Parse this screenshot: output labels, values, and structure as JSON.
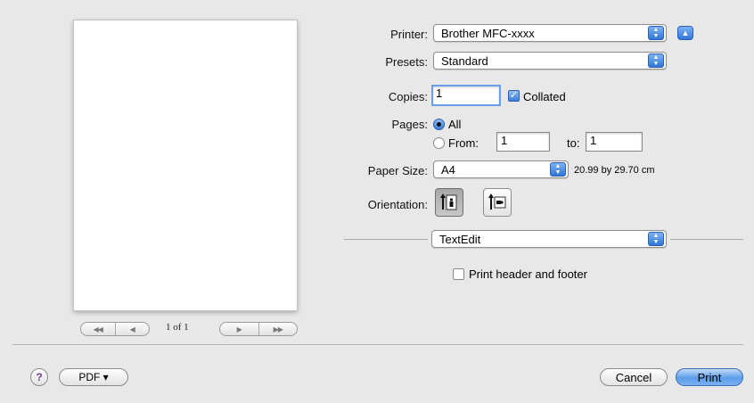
{
  "preview": {
    "page_counter": "1 of 1",
    "nav_first": "◀◀",
    "nav_prev": "◀",
    "nav_next": "▶",
    "nav_last": "▶▶"
  },
  "printer": {
    "label": "Printer:",
    "value": "Brother MFC-xxxx",
    "disclosure_glyph": "▲"
  },
  "presets": {
    "label": "Presets:",
    "value": "Standard"
  },
  "copies": {
    "label": "Copies:",
    "value": "1",
    "collated_label": "Collated",
    "collated_checked": true
  },
  "pages": {
    "label": "Pages:",
    "all_label": "All",
    "from_label": "From:",
    "from_value": "1",
    "to_label": "to:",
    "to_value": "1",
    "selected": "All"
  },
  "paper_size": {
    "label": "Paper Size:",
    "value": "A4",
    "dimensions": "20.99 by 29.70 cm"
  },
  "orientation": {
    "label": "Orientation:",
    "selected": "portrait"
  },
  "section_popup": {
    "value": "TextEdit"
  },
  "print_header_footer": {
    "label": "Print header and footer",
    "checked": false
  },
  "footer": {
    "help_glyph": "?",
    "pdf_label": "PDF ▾",
    "cancel_label": "Cancel",
    "print_label": "Print"
  },
  "colors": {
    "accent": "#3a7edc",
    "background": "#e8e8e8"
  }
}
